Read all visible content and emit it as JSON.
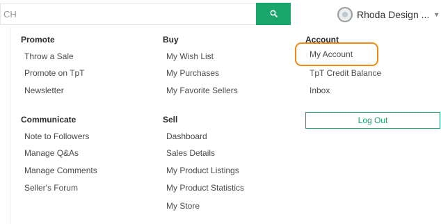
{
  "search": {
    "value": "CH",
    "placeholder": ""
  },
  "user": {
    "name": "Rhoda Design ..."
  },
  "menu": {
    "promote": {
      "title": "Promote",
      "items": [
        "Throw a Sale",
        "Promote on TpT",
        "Newsletter"
      ]
    },
    "communicate": {
      "title": "Communicate",
      "items": [
        "Note to Followers",
        "Manage Q&As",
        "Manage Comments",
        "Seller's Forum"
      ]
    },
    "buy": {
      "title": "Buy",
      "items": [
        "My Wish List",
        "My Purchases",
        "My Favorite Sellers"
      ]
    },
    "sell": {
      "title": "Sell",
      "items": [
        "Dashboard",
        "Sales Details",
        "My Product Listings",
        "My Product Statistics",
        "My Store"
      ]
    },
    "account": {
      "title": "Account",
      "items": [
        "My Account",
        "TpT Credit Balance",
        "Inbox"
      ],
      "logout_label": "Log Out"
    }
  },
  "colors": {
    "accent": "#1aa56a",
    "highlight": "#f28a12"
  },
  "icons": {
    "search": "search-icon",
    "avatar": "avatar",
    "caret": "chevron-down-icon"
  }
}
